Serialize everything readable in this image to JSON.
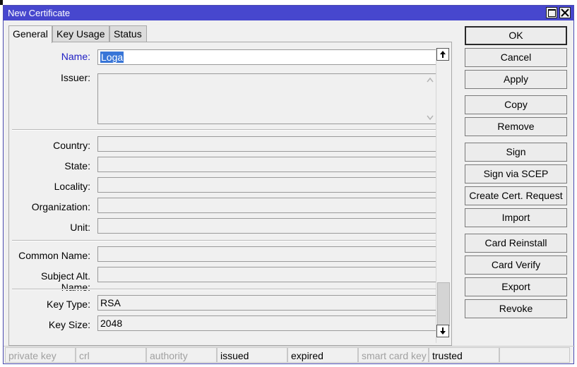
{
  "window": {
    "title": "New Certificate"
  },
  "tabs": [
    {
      "label": "General",
      "active": true
    },
    {
      "label": "Key Usage",
      "active": false
    },
    {
      "label": "Status",
      "active": false
    }
  ],
  "form": {
    "name": {
      "label": "Name:",
      "value": "Loga"
    },
    "issuer": {
      "label": "Issuer:",
      "value": ""
    },
    "country": {
      "label": "Country:",
      "value": ""
    },
    "state": {
      "label": "State:",
      "value": ""
    },
    "locality": {
      "label": "Locality:",
      "value": ""
    },
    "organization": {
      "label": "Organization:",
      "value": ""
    },
    "unit": {
      "label": "Unit:",
      "value": ""
    },
    "common_name": {
      "label": "Common Name:",
      "value": ""
    },
    "subject_alt_name": {
      "label": "Subject Alt. Name:",
      "value": ""
    },
    "key_type": {
      "label": "Key Type:",
      "value": "RSA"
    },
    "key_size": {
      "label": "Key Size:",
      "value": "2048"
    }
  },
  "buttons": {
    "ok": "OK",
    "cancel": "Cancel",
    "apply": "Apply",
    "copy": "Copy",
    "remove": "Remove",
    "sign": "Sign",
    "sign_scep": "Sign via SCEP",
    "create_request": "Create Cert. Request",
    "import": "Import",
    "card_reinstall": "Card Reinstall",
    "card_verify": "Card Verify",
    "export": "Export",
    "revoke": "Revoke"
  },
  "statusbar": [
    {
      "label": "private key",
      "active": false
    },
    {
      "label": "crl",
      "active": false
    },
    {
      "label": "authority",
      "active": false
    },
    {
      "label": "issued",
      "active": true
    },
    {
      "label": "expired",
      "active": true
    },
    {
      "label": "smart card key",
      "active": false
    },
    {
      "label": "trusted",
      "active": true
    },
    {
      "label": "",
      "active": false
    }
  ],
  "colors": {
    "titlebar": "#4747ce",
    "name_label": "#1d1dc4",
    "selection": "#3875d7"
  }
}
